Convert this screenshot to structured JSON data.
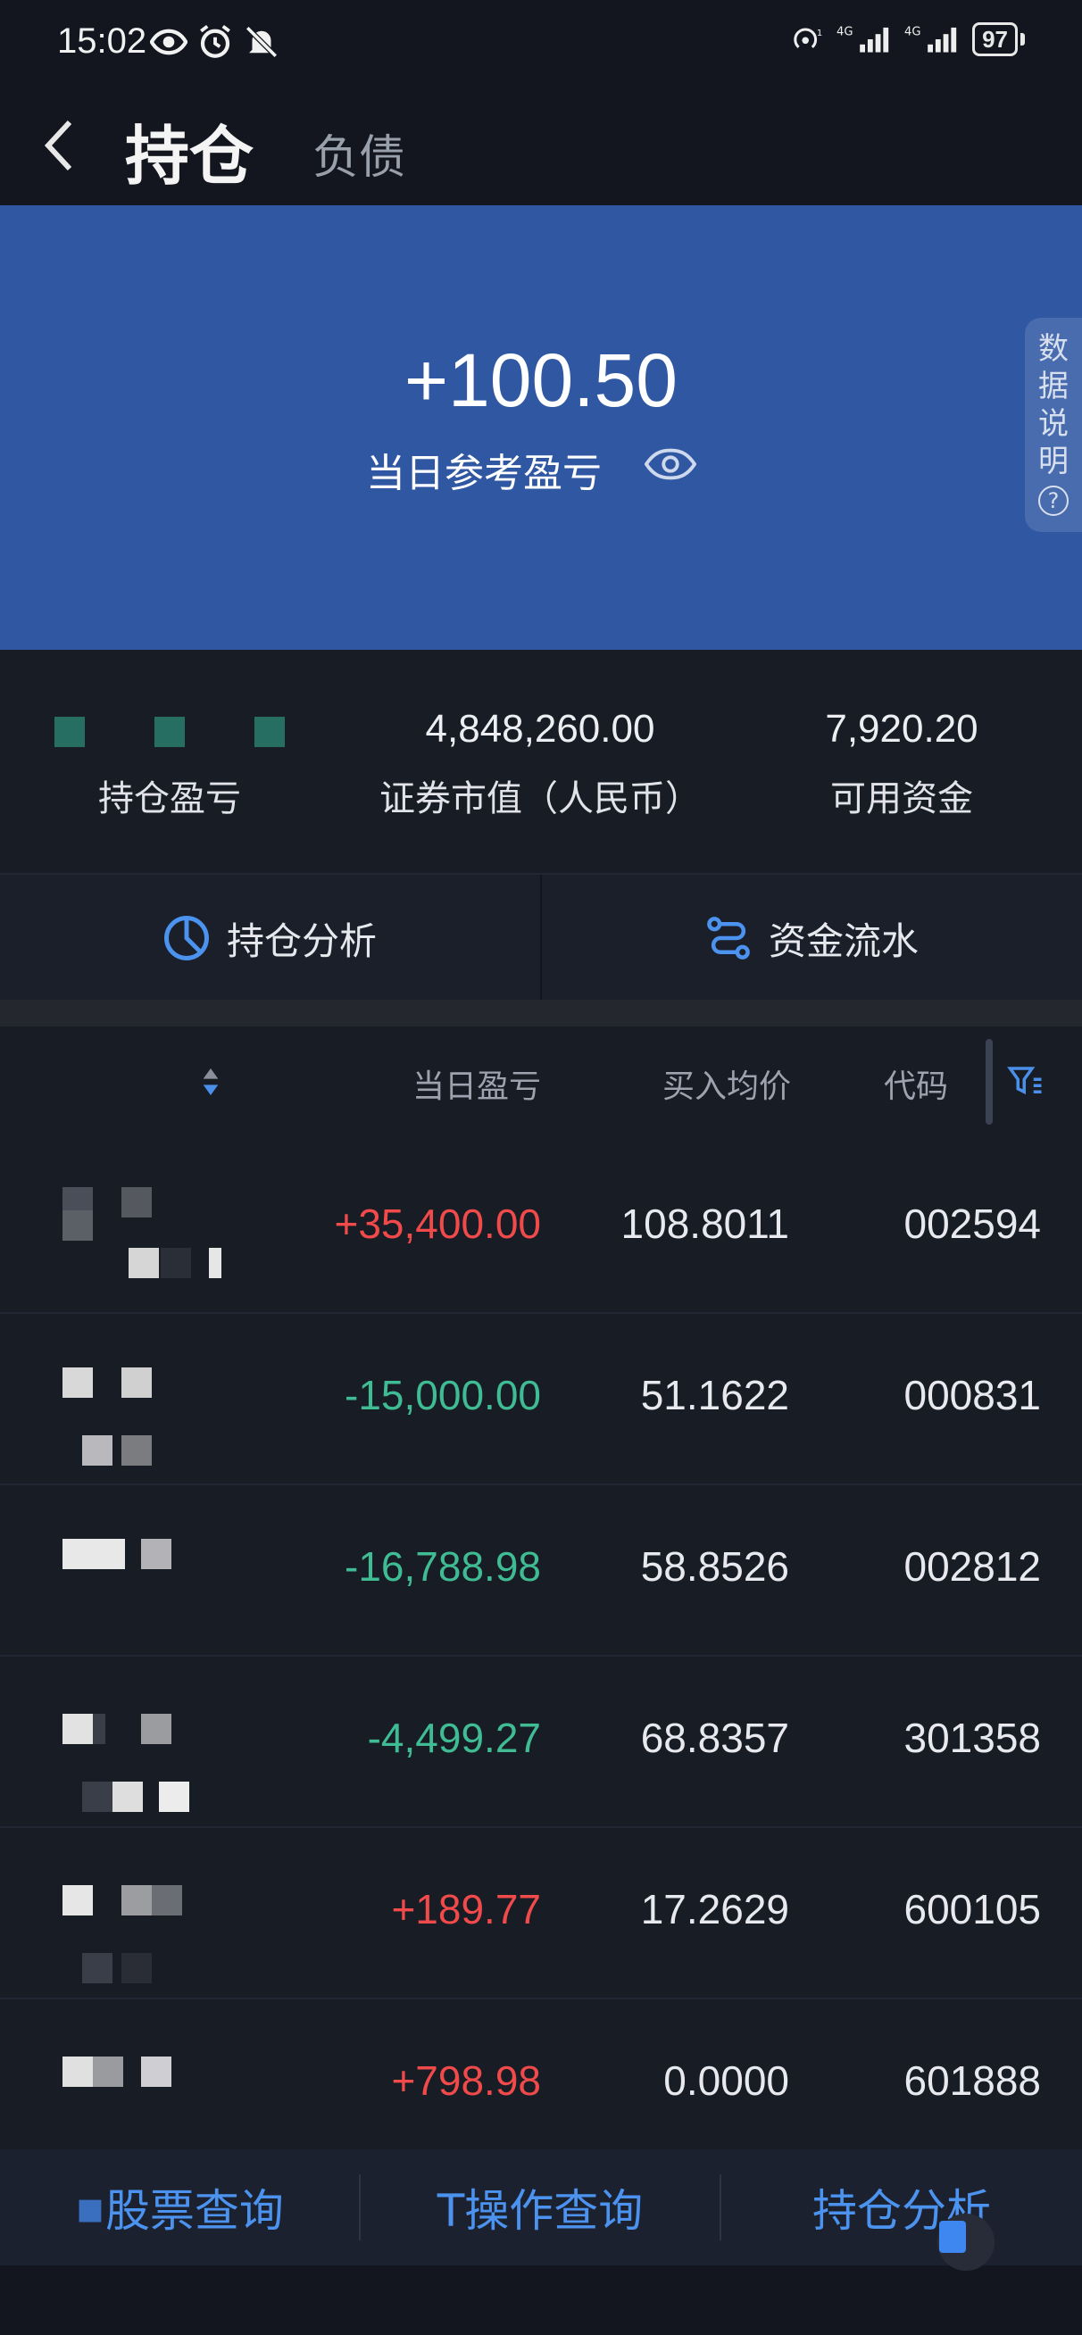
{
  "status_bar": {
    "time": "15:02",
    "left_icons": [
      "eye-icon",
      "alarm-icon",
      "mute-icon"
    ],
    "right_icons": [
      "hotspot-icon",
      "signal-4g-icon",
      "signal-4g-icon"
    ],
    "battery": "97"
  },
  "header": {
    "active_tab": "持仓",
    "inactive_tab": "负债"
  },
  "hero": {
    "value": "+100.50",
    "label": "当日参考盈亏",
    "side_explain": [
      "数",
      "据",
      "说",
      "明"
    ],
    "side_explain_icon": "?"
  },
  "summary": {
    "holding_pnl_label": "持仓盈亏",
    "market_value": "4,848,260.00",
    "market_value_label": "证券市值（人民币）",
    "available_funds": "7,920.20",
    "available_funds_label": "可用资金"
  },
  "actions": {
    "analysis": "持仓分析",
    "cash_flow": "资金流水"
  },
  "table": {
    "columns": {
      "daily_pnl": "当日盈亏",
      "avg_cost": "买入均价",
      "code": "代码"
    },
    "rows": [
      {
        "daily_pnl": "+35,400.00",
        "avg_cost": "108.8011",
        "code": "002594",
        "direction": "pos"
      },
      {
        "daily_pnl": "-15,000.00",
        "avg_cost": "51.1622",
        "code": "000831",
        "direction": "neg"
      },
      {
        "daily_pnl": "-16,788.98",
        "avg_cost": "58.8526",
        "code": "002812",
        "direction": "neg"
      },
      {
        "daily_pnl": "-4,499.27",
        "avg_cost": "68.8357",
        "code": "301358",
        "direction": "neg"
      },
      {
        "daily_pnl": "+189.77",
        "avg_cost": "17.2629",
        "code": "600105",
        "direction": "pos"
      },
      {
        "daily_pnl": "+798.98",
        "avg_cost": "0.0000",
        "code": "601888",
        "direction": "pos"
      }
    ]
  },
  "bottom_bar": {
    "stock_query": "股票查询",
    "t_query": "T操作查询",
    "holding_analysis": "持仓分析"
  },
  "colors": {
    "hero_blue": "#2f57a2",
    "gain_red": "#f04a4a",
    "loss_green": "#3fbc93",
    "accent_blue": "#4c93f0"
  }
}
